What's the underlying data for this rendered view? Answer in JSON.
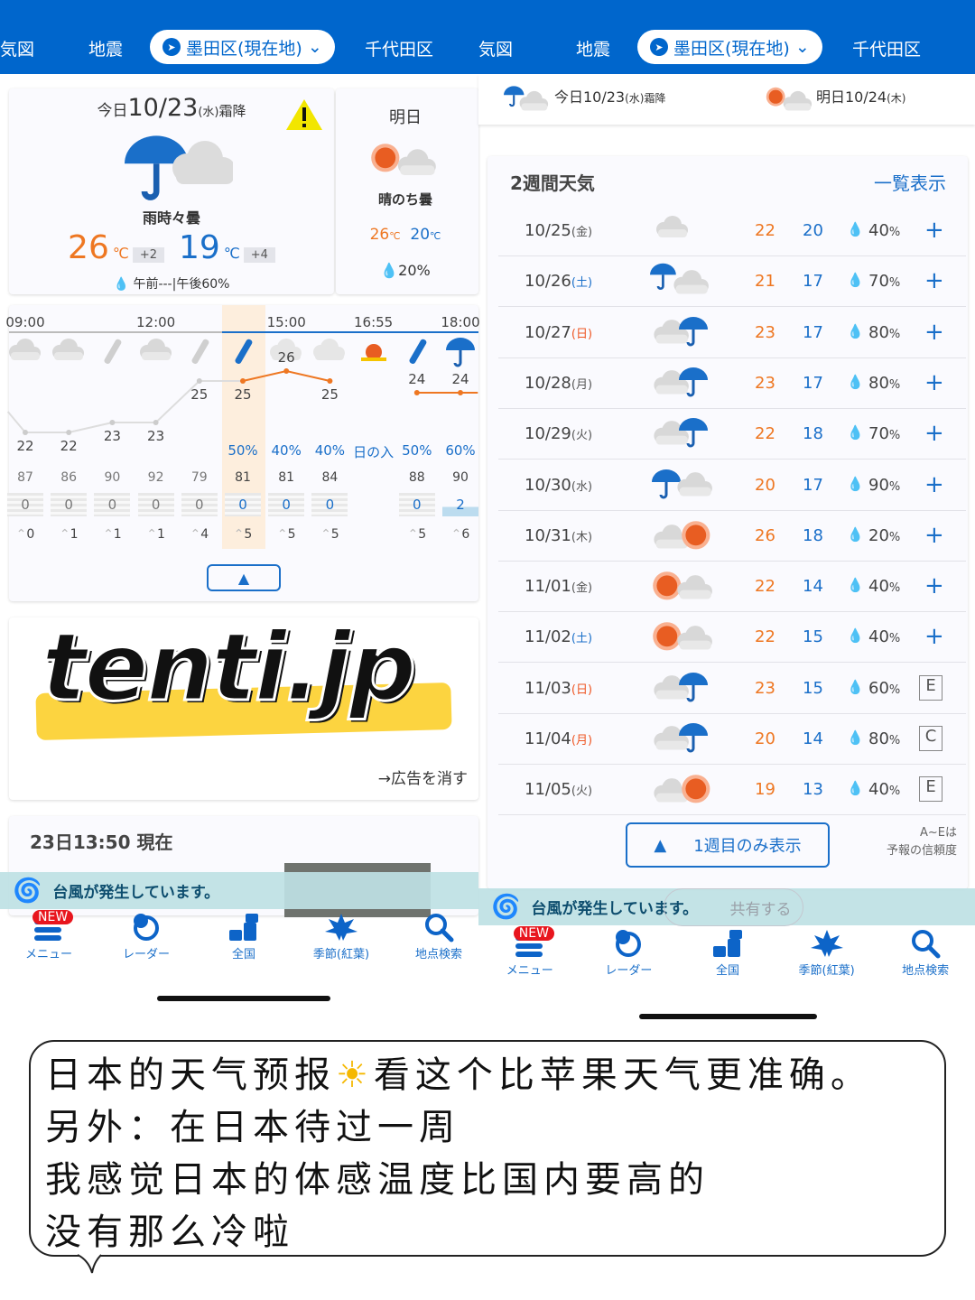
{
  "topnav": {
    "items": [
      "気図",
      "地震",
      "千代田区"
    ],
    "location": "墨田区(現在地)"
  },
  "today": {
    "label": "今日",
    "date": "10/23",
    "weekday": "(水)",
    "solar_term": "霜降",
    "weather": "雨時々曇",
    "high": "26",
    "low": "19",
    "unit": "℃",
    "high_diff": "+2",
    "low_diff": "+4",
    "precip": "午前---|午後60%",
    "warning_icon": "warning-icon"
  },
  "tomorrow": {
    "label": "明日",
    "weather": "晴のち曇",
    "high": "26",
    "low": "20",
    "unit": "℃",
    "precip": "20%"
  },
  "header_strip": {
    "today": "今日10/23",
    "today_sub": "(水)霜降",
    "tomorrow": "明日10/24",
    "tomorrow_sub": "(木)"
  },
  "hourly": {
    "time_labels": [
      [
        "09:00",
        0
      ],
      [
        "12:00",
        3
      ],
      [
        "15:00",
        6
      ],
      [
        "16:55",
        8
      ],
      [
        "18:00",
        10
      ]
    ],
    "icons": [
      "cloud",
      "cloud",
      "drizzle-gray",
      "cloud",
      "drizzle-gray",
      "drizzle",
      "cloud-light",
      "cloud-light",
      "sunset",
      "drizzle",
      "umbrella"
    ],
    "temps": [
      "22",
      "22",
      "23",
      "23",
      "25",
      "25",
      "26",
      "25",
      "",
      "24",
      "24"
    ],
    "precip": [
      "",
      "",
      "",
      "",
      "",
      "50%",
      "40%",
      "40%",
      "日の入",
      "50%",
      "60%"
    ],
    "humidity": [
      "87",
      "86",
      "90",
      "92",
      "79",
      "81",
      "81",
      "84",
      "",
      "88",
      "90"
    ],
    "rain": [
      "0",
      "0",
      "0",
      "0",
      "0",
      "0",
      "0",
      "0",
      "",
      "0",
      "2"
    ],
    "wind": [
      "0",
      "1",
      "1",
      "1",
      "4",
      "5",
      "5",
      "5",
      "",
      "5",
      "6"
    ],
    "current_index": 5
  },
  "ad": {
    "logo_text": "tenti.jp",
    "remove": "→広告を消す"
  },
  "observation": {
    "title": "23日13:50 現在"
  },
  "typhoon": "台風が発生しています。",
  "share": "共有する",
  "weekly": {
    "title": "2週間天気",
    "list_link": "一覧表示",
    "collapse": "1週目のみ表示",
    "note1": "A~Eは",
    "note2": "予報の信頼度",
    "colors": {
      "high": "#ee7722",
      "low": "#1a6fc9",
      "sat": "#1a6fc9",
      "holiday": "#ee5522"
    },
    "rows": [
      {
        "date": "10/25",
        "wd": "(金)",
        "wdc": "",
        "icon": "cloud",
        "hi": "22",
        "lo": "20",
        "pop": "40",
        "act": "+"
      },
      {
        "date": "10/26",
        "wd": "(土)",
        "wdc": "sat",
        "icon": "rain-then-cloud",
        "hi": "21",
        "lo": "17",
        "pop": "70",
        "act": "+"
      },
      {
        "date": "10/27",
        "wd": "(日)",
        "wdc": "holiday",
        "icon": "cloud-rain",
        "hi": "23",
        "lo": "17",
        "pop": "80",
        "act": "+"
      },
      {
        "date": "10/28",
        "wd": "(月)",
        "wdc": "",
        "icon": "cloud-rain",
        "hi": "23",
        "lo": "17",
        "pop": "80",
        "act": "+"
      },
      {
        "date": "10/29",
        "wd": "(火)",
        "wdc": "",
        "icon": "cloud-rain",
        "hi": "22",
        "lo": "18",
        "pop": "70",
        "act": "+"
      },
      {
        "date": "10/30",
        "wd": "(水)",
        "wdc": "",
        "icon": "rain-cloud",
        "hi": "20",
        "lo": "17",
        "pop": "90",
        "act": "+"
      },
      {
        "date": "10/31",
        "wd": "(木)",
        "wdc": "",
        "icon": "cloud-sun",
        "hi": "26",
        "lo": "18",
        "pop": "20",
        "act": "+"
      },
      {
        "date": "11/01",
        "wd": "(金)",
        "wdc": "",
        "icon": "sun-cloud",
        "hi": "22",
        "lo": "14",
        "pop": "40",
        "act": "+"
      },
      {
        "date": "11/02",
        "wd": "(土)",
        "wdc": "sat",
        "icon": "sun-cloud",
        "hi": "22",
        "lo": "15",
        "pop": "40",
        "act": "+"
      },
      {
        "date": "11/03",
        "wd": "(日)",
        "wdc": "holiday",
        "icon": "cloud-rain",
        "hi": "23",
        "lo": "15",
        "pop": "60",
        "act": "E"
      },
      {
        "date": "11/04",
        "wd": "(月)",
        "wdc": "holiday",
        "icon": "cloud-rain",
        "hi": "20",
        "lo": "14",
        "pop": "80",
        "act": "C"
      },
      {
        "date": "11/05",
        "wd": "(火)",
        "wdc": "",
        "icon": "cloud-sun",
        "hi": "19",
        "lo": "13",
        "pop": "40",
        "act": "E"
      }
    ]
  },
  "tabbar": {
    "new_badge": "NEW",
    "items": [
      {
        "label": "メニュー",
        "icon": "menu-icon"
      },
      {
        "label": "レーダー",
        "icon": "radar-icon"
      },
      {
        "label": "全国",
        "icon": "japan-map-icon"
      },
      {
        "label": "季節(紅葉)",
        "icon": "maple-leaf-icon"
      },
      {
        "label": "地点検索",
        "icon": "search-icon"
      }
    ]
  },
  "caption": {
    "lines": [
      "日本的天气预报",
      "看这个比苹果天气更准确。",
      "另外：在日本待过一周",
      "我感觉日本的体感温度比国内要高的",
      "没有那么冷啦"
    ]
  }
}
